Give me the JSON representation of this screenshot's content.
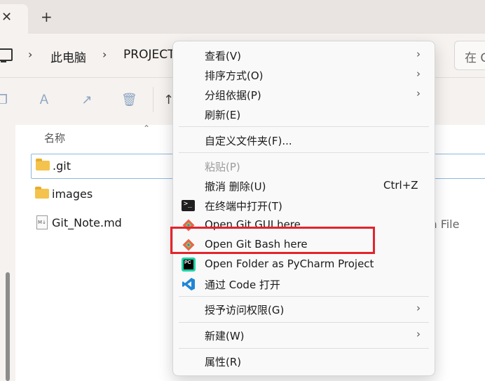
{
  "window": {
    "tab_close": "✕",
    "new_tab": "+"
  },
  "breadcrumb": {
    "items": [
      "此电脑",
      "PROJECT"
    ],
    "search_placeholder": "在 C"
  },
  "file_list": {
    "column_name": "名称",
    "files": [
      {
        "name": ".git",
        "type": "folder"
      },
      {
        "name": "images",
        "type": "folder"
      },
      {
        "name": "Git_Note.md",
        "type": "markdown"
      }
    ],
    "partial_type_text": "vn File"
  },
  "context_menu": {
    "items": [
      {
        "label": "查看(V)",
        "submenu": true
      },
      {
        "label": "排序方式(O)",
        "submenu": true
      },
      {
        "label": "分组依据(P)",
        "submenu": true
      },
      {
        "label": "刷新(E)"
      },
      {
        "label": "自定义文件夹(F)..."
      },
      {
        "label": "粘贴(P)",
        "disabled": true
      },
      {
        "label": "撤消 删除(U)",
        "shortcut": "Ctrl+Z"
      },
      {
        "label": "在终端中打开(T)",
        "icon": "terminal-icon"
      },
      {
        "label": "Open Git GUI here",
        "icon": "git-icon"
      },
      {
        "label": "Open Git Bash here",
        "icon": "git-icon"
      },
      {
        "label": "Open Folder as PyCharm Project",
        "icon": "pycharm-icon"
      },
      {
        "label": "通过 Code 打开",
        "icon": "vscode-icon"
      },
      {
        "label": "授予访问权限(G)",
        "submenu": true
      },
      {
        "label": "新建(W)",
        "submenu": true
      },
      {
        "label": "属性(R)"
      }
    ],
    "highlight_color": "#e4232b"
  }
}
